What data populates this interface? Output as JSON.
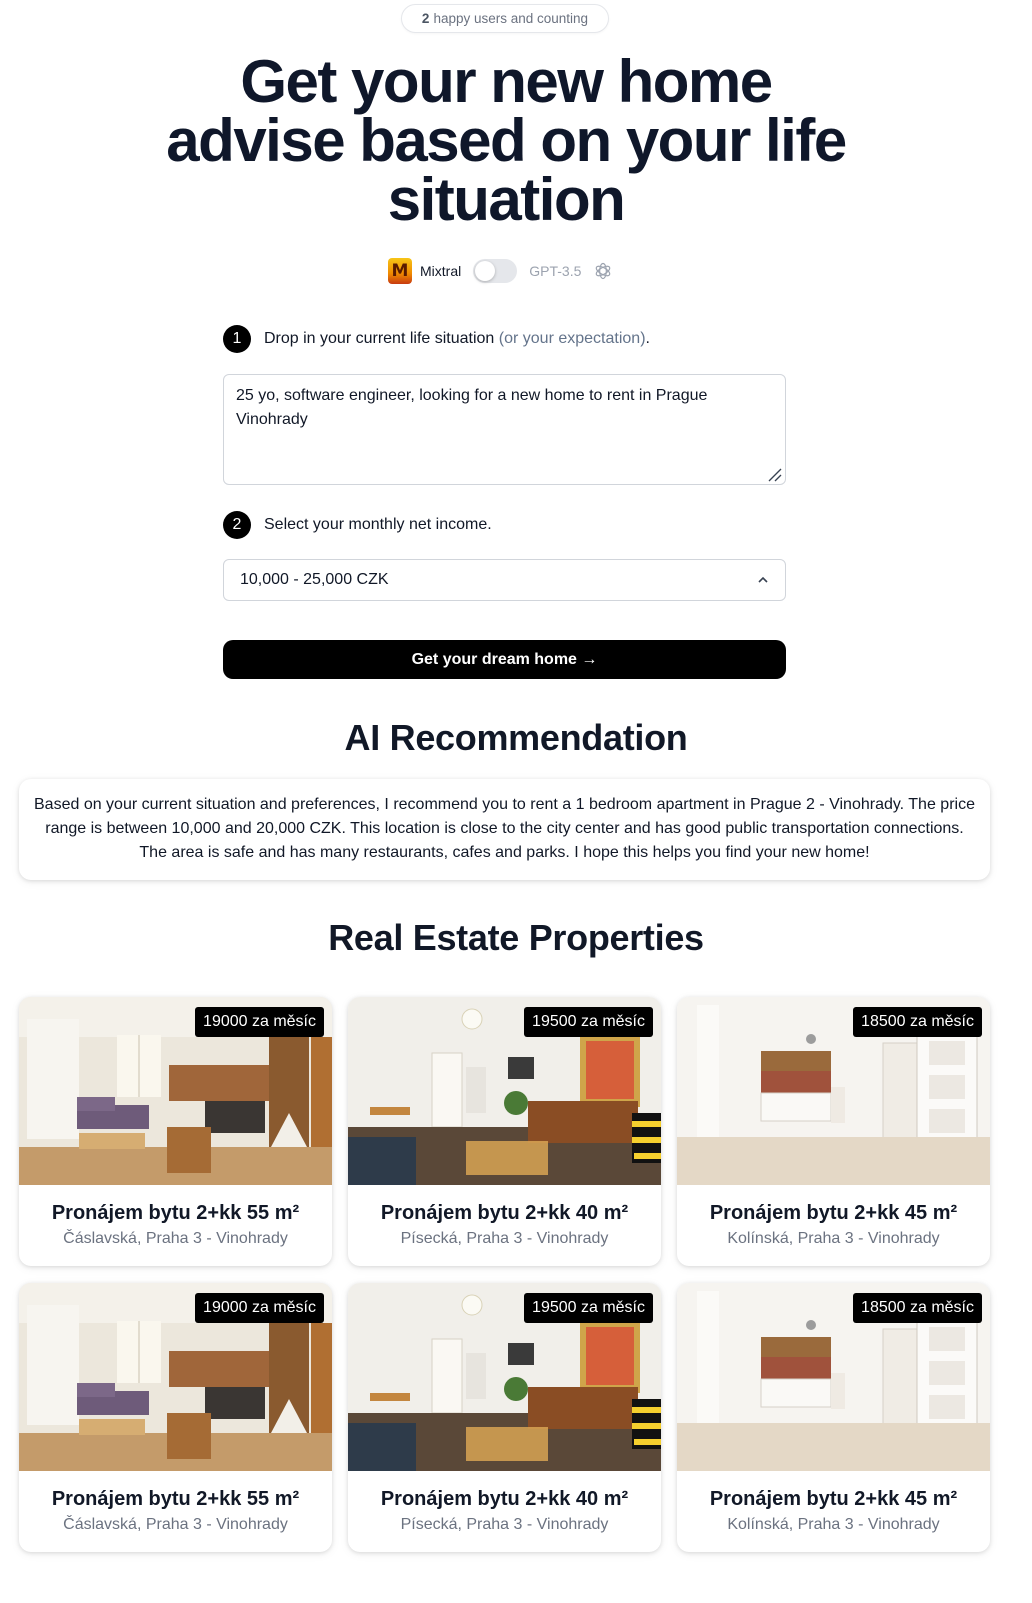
{
  "top_badge": {
    "count": "2",
    "text": "happy users and counting"
  },
  "hero": {
    "title_lines": [
      "Get your new home",
      "advise based on your life",
      "situation"
    ]
  },
  "model_switch": {
    "left_label": "Mixtral",
    "right_label": "GPT-3.5",
    "selected": "Mixtral"
  },
  "step1": {
    "number": "1",
    "label": "Drop in your current life situation",
    "hint": "(or your expectation)",
    "trail": "."
  },
  "situation_input": {
    "value": "25 yo, software engineer, looking for a new home to rent in Prague Vinohrady"
  },
  "step2": {
    "number": "2",
    "label": "Select your monthly net income."
  },
  "income_select": {
    "value": "10,000 - 25,000 CZK"
  },
  "cta": {
    "label": "Get your dream home →"
  },
  "ai_section": {
    "title": "AI Recommendation",
    "text": "Based on your current situation and preferences, I recommend you to rent a 1 bedroom apartment in Prague 2 - Vinohrady. The price range is between 10,000 and 20,000 CZK. This location is close to the city center and has good public transportation connections. The area is safe and has many restaurants, cafes and parks. I hope this helps you find your new home!"
  },
  "properties_section": {
    "title": "Real Estate Properties",
    "items": [
      {
        "price": "19000 za měsíc",
        "title": "Pronájem bytu 2+kk 55 m²",
        "address": "Čáslavská, Praha 3 - Vinohrady"
      },
      {
        "price": "19500 za měsíc",
        "title": "Pronájem bytu 2+kk 40 m²",
        "address": "Písecká, Praha 3 - Vinohrady"
      },
      {
        "price": "18500 za měsíc",
        "title": "Pronájem bytu 2+kk 45 m²",
        "address": "Kolínská, Praha 3 - Vinohrady"
      },
      {
        "price": "19000 za měsíc",
        "title": "Pronájem bytu 2+kk 55 m²",
        "address": "Čáslavská, Praha 3 - Vinohrady"
      },
      {
        "price": "19500 za měsíc",
        "title": "Pronájem bytu 2+kk 40 m²",
        "address": "Písecká, Praha 3 - Vinohrady"
      },
      {
        "price": "18500 za měsíc",
        "title": "Pronájem bytu 2+kk 45 m²",
        "address": "Kolínská, Praha 3 - Vinohrady"
      }
    ]
  },
  "colors": {
    "primary": "#000000",
    "heading": "#0f172a",
    "muted": "#6b7280",
    "hint": "#64748b"
  },
  "icons": {
    "mixtral": "mixtral-logo-icon",
    "openai": "openai-icon",
    "chevron": "chevron-up-icon"
  }
}
